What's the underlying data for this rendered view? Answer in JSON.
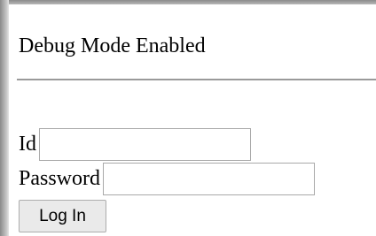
{
  "page": {
    "heading": "Debug Mode Enabled"
  },
  "login_form": {
    "id_label": "Id",
    "id_value": "",
    "password_label": "Password",
    "password_value": "",
    "submit_label": "Log In"
  }
}
